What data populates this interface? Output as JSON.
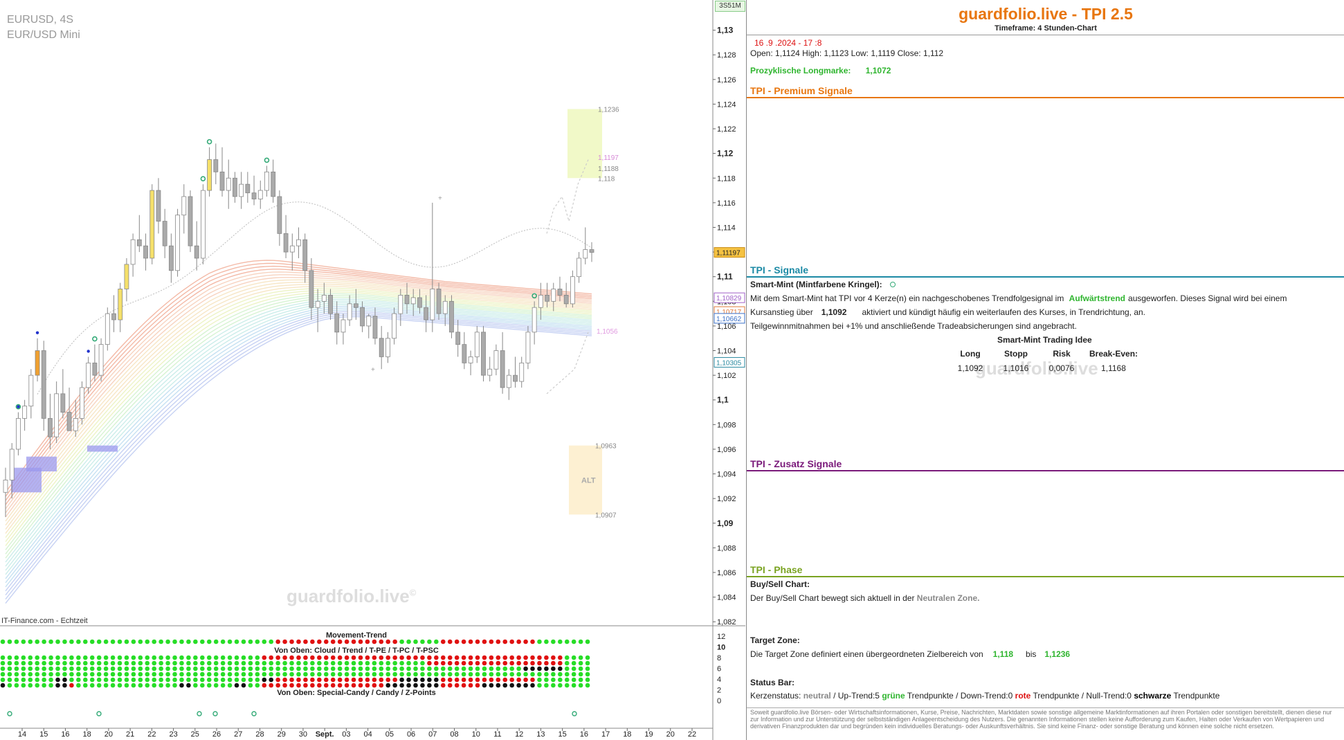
{
  "chart": {
    "symbol": "EURUSD, 4S",
    "name": "EUR/USD Mini",
    "corner_badge": "3S51M",
    "source": "IT-Finance.com - Echtzeit",
    "watermark": "guardfolio.live",
    "watermark_mark": "©",
    "alt_label": "ALT"
  },
  "chart_data": {
    "type": "candlestick",
    "y_axis": {
      "min": 1.081,
      "max": 1.132,
      "ticks": [
        "1,13",
        "1,128",
        "1,126",
        "1,124",
        "1,122",
        "1,12",
        "1,118",
        "1,116",
        "1,114",
        "1,112",
        "1,11",
        "1,108",
        "1,106",
        "1,104",
        "1,102",
        "1,1",
        "1,098",
        "1,096",
        "1,094",
        "1,092",
        "1,09",
        "1,088",
        "1,086",
        "1,084",
        "1,082"
      ],
      "bold_ticks": [
        "1,13",
        "1,12",
        "1,11",
        "1,1",
        "1,09"
      ]
    },
    "x_axis": {
      "ticks": [
        "14",
        "15",
        "16",
        "18",
        "20",
        "21",
        "22",
        "23",
        "25",
        "26",
        "27",
        "28",
        "29",
        "30",
        "Sept.",
        "03",
        "04",
        "05",
        "06",
        "07",
        "08",
        "10",
        "11",
        "12",
        "13",
        "15",
        "16",
        "17",
        "18",
        "19",
        "20",
        "22"
      ]
    },
    "price_labels": [
      {
        "text": "1,11197",
        "value": 1.11197,
        "style": "current"
      },
      {
        "text": "1,10829",
        "value": 1.10829,
        "style": "purple"
      },
      {
        "text": "1,10717",
        "value": 1.10717,
        "style": "orange"
      },
      {
        "text": "1,10662",
        "value": 1.10662,
        "style": "blue"
      },
      {
        "text": "1,10305",
        "value": 1.10305,
        "style": "teal"
      }
    ],
    "target_zone": {
      "low": 1.118,
      "high": 1.1236,
      "labels": [
        "1,1236",
        "1,1197",
        "1,1188",
        "1,118"
      ]
    },
    "alt_zone": {
      "low": 1.0907,
      "high": 1.0963,
      "labels": [
        "1,0963",
        "1,0907"
      ]
    },
    "pink_level": {
      "value": 1.1056,
      "label": "1,1056"
    },
    "candles": [
      [
        1.0925,
        1.0945,
        1.0905,
        1.0935
      ],
      [
        1.0935,
        1.0965,
        1.092,
        1.096
      ],
      [
        1.096,
        1.099,
        1.0955,
        1.0985
      ],
      [
        1.0985,
        1.1,
        1.0975,
        1.0995
      ],
      [
        1.0995,
        1.1025,
        1.0985,
        1.102
      ],
      [
        1.102,
        1.105,
        1.1015,
        1.104
      ],
      [
        1.104,
        1.1048,
        1.0975,
        1.0985
      ],
      [
        1.0985,
        1.1005,
        1.096,
        1.097
      ],
      [
        1.097,
        1.1015,
        1.0965,
        1.1005
      ],
      [
        1.1005,
        1.1025,
        1.0985,
        1.099
      ],
      [
        1.099,
        1.101,
        1.098,
        1.0975
      ],
      [
        1.0975,
        1.1,
        1.097,
        1.0985
      ],
      [
        1.0985,
        1.1015,
        1.098,
        1.101
      ],
      [
        1.101,
        1.1035,
        1.1005,
        1.103
      ],
      [
        1.103,
        1.1045,
        1.1015,
        1.102
      ],
      [
        1.102,
        1.105,
        1.1015,
        1.1045
      ],
      [
        1.1045,
        1.1075,
        1.104,
        1.107
      ],
      [
        1.107,
        1.1085,
        1.1055,
        1.1065
      ],
      [
        1.1065,
        1.1095,
        1.1055,
        1.109
      ],
      [
        1.109,
        1.1115,
        1.108,
        1.111
      ],
      [
        1.111,
        1.1135,
        1.11,
        1.113
      ],
      [
        1.113,
        1.115,
        1.112,
        1.1125
      ],
      [
        1.1125,
        1.1135,
        1.1105,
        1.1115
      ],
      [
        1.1115,
        1.1175,
        1.111,
        1.117
      ],
      [
        1.117,
        1.118,
        1.1135,
        1.1145
      ],
      [
        1.1145,
        1.1155,
        1.1115,
        1.1125
      ],
      [
        1.1125,
        1.1135,
        1.1095,
        1.1105
      ],
      [
        1.1105,
        1.1155,
        1.11,
        1.115
      ],
      [
        1.115,
        1.1175,
        1.1135,
        1.1165
      ],
      [
        1.1165,
        1.117,
        1.112,
        1.1125
      ],
      [
        1.1125,
        1.1145,
        1.1105,
        1.1115
      ],
      [
        1.1115,
        1.1175,
        1.111,
        1.117
      ],
      [
        1.117,
        1.1205,
        1.1165,
        1.1195
      ],
      [
        1.1195,
        1.1208,
        1.1175,
        1.1185
      ],
      [
        1.1185,
        1.1205,
        1.1165,
        1.117
      ],
      [
        1.117,
        1.1195,
        1.1155,
        1.118
      ],
      [
        1.118,
        1.1185,
        1.116,
        1.1165
      ],
      [
        1.1165,
        1.1185,
        1.1155,
        1.1175
      ],
      [
        1.1175,
        1.1185,
        1.116,
        1.1168
      ],
      [
        1.1168,
        1.1182,
        1.1158,
        1.1163
      ],
      [
        1.1163,
        1.1178,
        1.1155,
        1.117
      ],
      [
        1.117,
        1.119,
        1.1165,
        1.1185
      ],
      [
        1.1185,
        1.1195,
        1.116,
        1.1165
      ],
      [
        1.1165,
        1.117,
        1.1125,
        1.1135
      ],
      [
        1.1135,
        1.115,
        1.1115,
        1.112
      ],
      [
        1.112,
        1.1135,
        1.1105,
        1.1125
      ],
      [
        1.1125,
        1.114,
        1.1115,
        1.113
      ],
      [
        1.113,
        1.1135,
        1.1095,
        1.1105
      ],
      [
        1.1105,
        1.1115,
        1.1065,
        1.1075
      ],
      [
        1.1075,
        1.109,
        1.1055,
        1.108
      ],
      [
        1.108,
        1.1095,
        1.107,
        1.1085
      ],
      [
        1.1085,
        1.109,
        1.1065,
        1.107
      ],
      [
        1.107,
        1.108,
        1.1045,
        1.1055
      ],
      [
        1.1055,
        1.107,
        1.1045,
        1.1065
      ],
      [
        1.1065,
        1.1085,
        1.106,
        1.1078
      ],
      [
        1.1078,
        1.109,
        1.1065,
        1.1075
      ],
      [
        1.1075,
        1.108,
        1.1055,
        1.106
      ],
      [
        1.106,
        1.107,
        1.105,
        1.1068
      ],
      [
        1.1068,
        1.1075,
        1.1045,
        1.105
      ],
      [
        1.105,
        1.106,
        1.1025,
        1.1035
      ],
      [
        1.1035,
        1.1055,
        1.103,
        1.105
      ],
      [
        1.105,
        1.1075,
        1.1045,
        1.107
      ],
      [
        1.107,
        1.109,
        1.106,
        1.1085
      ],
      [
        1.1085,
        1.1095,
        1.107,
        1.1078
      ],
      [
        1.1078,
        1.109,
        1.1068,
        1.1083
      ],
      [
        1.1083,
        1.109,
        1.107,
        1.1075
      ],
      [
        1.1075,
        1.1085,
        1.1055,
        1.1065
      ],
      [
        1.1065,
        1.116,
        1.1055,
        1.109
      ],
      [
        1.109,
        1.1095,
        1.1065,
        1.107
      ],
      [
        1.107,
        1.1085,
        1.106,
        1.108
      ],
      [
        1.108,
        1.1085,
        1.105,
        1.1055
      ],
      [
        1.1055,
        1.1065,
        1.1035,
        1.1045
      ],
      [
        1.1045,
        1.1055,
        1.1025,
        1.103
      ],
      [
        1.103,
        1.104,
        1.102,
        1.1035
      ],
      [
        1.1035,
        1.106,
        1.103,
        1.1055
      ],
      [
        1.1055,
        1.106,
        1.1015,
        1.102
      ],
      [
        1.102,
        1.1035,
        1.1015,
        1.1025
      ],
      [
        1.1025,
        1.1045,
        1.102,
        1.104
      ],
      [
        1.104,
        1.1055,
        1.1005,
        1.101
      ],
      [
        1.101,
        1.1025,
        1.1,
        1.102
      ],
      [
        1.102,
        1.1035,
        1.101,
        1.1015
      ],
      [
        1.1015,
        1.1035,
        1.101,
        1.103
      ],
      [
        1.103,
        1.106,
        1.1025,
        1.1055
      ],
      [
        1.1055,
        1.108,
        1.1045,
        1.1075
      ],
      [
        1.1075,
        1.1095,
        1.1065,
        1.1085
      ],
      [
        1.1085,
        1.1095,
        1.1075,
        1.108
      ],
      [
        1.108,
        1.1095,
        1.1072,
        1.109
      ],
      [
        1.109,
        1.11,
        1.108,
        1.1085
      ],
      [
        1.1085,
        1.1095,
        1.1075,
        1.1078
      ],
      [
        1.1078,
        1.1105,
        1.1075,
        1.11
      ],
      [
        1.11,
        1.112,
        1.1095,
        1.1115
      ],
      [
        1.1115,
        1.114,
        1.111,
        1.1122
      ],
      [
        1.1122,
        1.1128,
        1.1112,
        1.11197
      ]
    ],
    "highlight_candles": {
      "orange": [
        5
      ],
      "yellow": [
        18,
        19,
        23,
        32
      ]
    },
    "signal_circles_idx": [
      2,
      14,
      31,
      32,
      41,
      83
    ],
    "blue_dots_idx": [
      2,
      5,
      13
    ],
    "movement_trend_title": "Movement-Trend",
    "cloud_title": "Von Oben: Cloud / Trend / T-PE / T-PC / T-PSC",
    "candy_title": "Von Oben: Special-Candy / Candy / Z-Points",
    "subchart_ticks": [
      "12",
      "10",
      "8",
      "6",
      "4",
      "2",
      "0"
    ],
    "ribbon_rows": [
      [
        [
          0,
          40,
          "g"
        ],
        [
          40,
          42,
          "r"
        ],
        [
          42,
          58,
          "r"
        ],
        [
          58,
          64,
          "g"
        ],
        [
          64,
          78,
          "r"
        ],
        [
          78,
          86,
          "g"
        ]
      ],
      [
        [
          0,
          38,
          "g"
        ],
        [
          38,
          82,
          "r"
        ],
        [
          82,
          86,
          "g"
        ]
      ],
      [
        [
          0,
          62,
          "g"
        ],
        [
          62,
          82,
          "r"
        ],
        [
          82,
          86,
          "g"
        ]
      ],
      [
        [
          0,
          76,
          "g"
        ],
        [
          76,
          82,
          "k"
        ],
        [
          82,
          86,
          "g"
        ]
      ],
      [
        [
          0,
          86,
          "g"
        ]
      ],
      [
        [
          0,
          8,
          "g"
        ],
        [
          8,
          10,
          "k"
        ],
        [
          10,
          38,
          "g"
        ],
        [
          38,
          40,
          "k"
        ],
        [
          40,
          58,
          "r"
        ],
        [
          58,
          64,
          "k"
        ],
        [
          64,
          78,
          "r"
        ],
        [
          78,
          86,
          "g"
        ]
      ],
      [
        [
          0,
          1,
          "k"
        ],
        [
          1,
          8,
          "g"
        ],
        [
          8,
          10,
          "k"
        ],
        [
          10,
          11,
          "r"
        ],
        [
          11,
          26,
          "g"
        ],
        [
          26,
          28,
          "k"
        ],
        [
          28,
          34,
          "g"
        ],
        [
          34,
          36,
          "k"
        ],
        [
          36,
          38,
          "g"
        ],
        [
          38,
          56,
          "r"
        ],
        [
          56,
          64,
          "k"
        ],
        [
          64,
          70,
          "r"
        ],
        [
          70,
          78,
          "k"
        ],
        [
          78,
          86,
          "g"
        ]
      ]
    ]
  },
  "panel": {
    "title": "guardfolio.live - TPI 2.5",
    "timeframe": "Timeframe: 4 Stunden-Chart",
    "date": "16 .9 .2024 - 17 :8",
    "ohlc": "Open:  1,1124      High:  1,1123      Low:   1,1119     Close:   1,112",
    "longmarke_label": "Prozyklische Longmarke:",
    "longmarke_value": "1,1072",
    "premium_title": "TPI - Premium Signale",
    "signale_title": "TPI - Signale",
    "smart_mint_label": "Smart-Mint (Mintfarbene Kringel):",
    "sm_line1_a": "Mit dem Smart-Mint hat TPI vor 4  Kerze(n) ein nachgeschobenes Trendfolgesignal im",
    "sm_line1_trend": "Aufwärtstrend",
    "sm_line1_b": "ausgeworfen. Dieses Signal wird bei einem",
    "sm_line2_a": "Kursanstieg über",
    "sm_line2_value": "1,1092",
    "sm_line2_b": "aktiviert und kündigt häufig ein weiterlaufen des Kurses, in Trendrichtung, an.",
    "sm_line3": "Teilgewinnmitnahmen bei +1% und anschließende Tradeabsicherungen sind angebracht.",
    "trade_title": "Smart-Mint Trading Idee",
    "trade_headers": [
      "Long",
      "Stopp",
      "Risk",
      "Break-Even:"
    ],
    "trade_values": [
      "1,1092",
      "1,1016",
      "0,0076",
      "1,1168"
    ],
    "zusatz_title": "TPI - Zusatz Signale",
    "phase_title": "TPI - Phase",
    "buysell_label": "Buy/Sell Chart:",
    "buysell_text": "Der Buy/Sell Chart bewegt sich aktuell in der",
    "buysell_zone": "Neutralen Zone.",
    "target_label": "Target Zone:",
    "target_text": "Die Target Zone definiert einen übergeordneten Zielbereich von",
    "target_from": "1,118",
    "target_bis": "bis",
    "target_to": "1,1236",
    "status_label": "Status Bar:",
    "status_prefix": "Kerzenstatus:",
    "status_neutral": "neutral",
    "status_up": " / Up-Trend:5",
    "status_green": "grüne",
    "status_tp1": "Trendpunkte  / Down-Trend:0",
    "status_red": "rote",
    "status_tp2": "Trendpunkte / Null-Trend:0",
    "status_black": "schwarze",
    "status_tp3": "Trendpunkte",
    "disclaimer": "Soweit guardfolio.live Börsen- oder Wirtschaftsinformationen, Kurse, Preise, Nachrichten, Marktdaten sowie sonstige allgemeine Marktinformationen auf ihren Portalen oder sonstigen bereitstellt, dienen diese nur zur Information und zur Unterstützung der selbstständigen Anlageentscheidung des Nutzers. Die genannten Informationen stellen keine Aufforderung zum Kaufen, Halten oder Verkaufen von Wertpapieren und derivativen Finanzprodukten dar und begründen kein individuelles Beratungs- oder Auskunftsverhältnis. Sie sind keine Finanz- oder sonstige Beratung und können eine solche nicht ersetzen.",
    "watermark": "guardfolio.live"
  },
  "colors": {
    "orange_title": "#e8760f",
    "teal": "#1c8aa5",
    "purple": "#7a1a7a",
    "olive": "#7aa321",
    "green": "#2fb52f",
    "red": "#d11"
  }
}
